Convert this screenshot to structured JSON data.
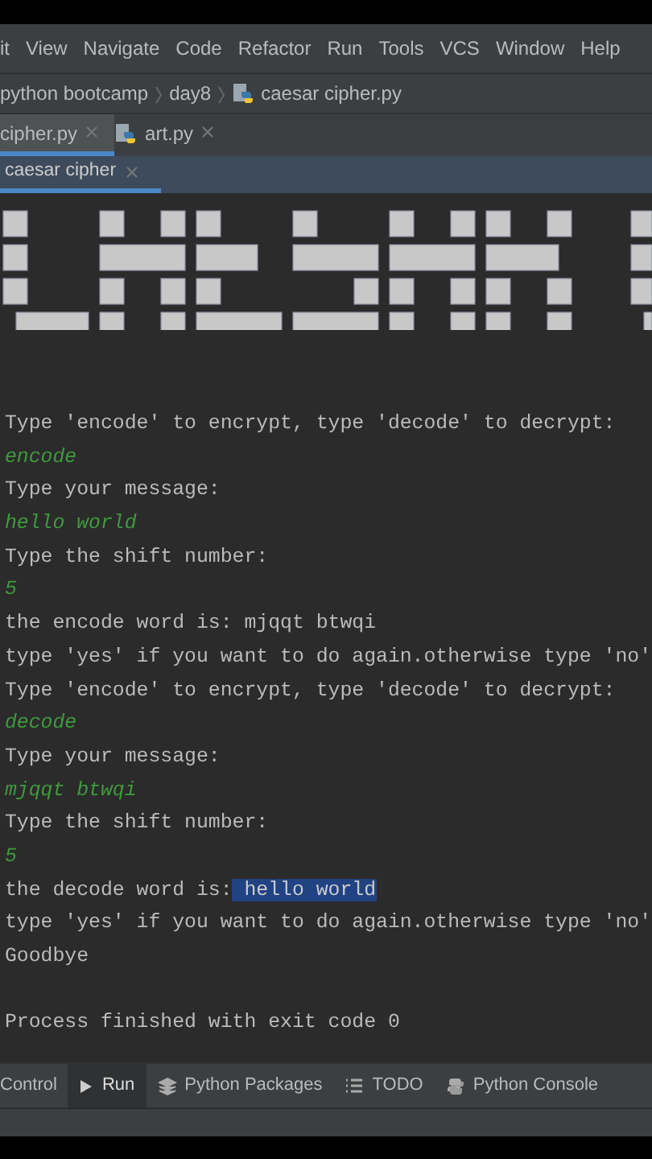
{
  "menu": [
    "it",
    "View",
    "Navigate",
    "Code",
    "Refactor",
    "Run",
    "Tools",
    "VCS",
    "Window",
    "Help"
  ],
  "breadcrumb": [
    {
      "label": "python bootcamp",
      "kind": "folder"
    },
    {
      "label": "day8",
      "kind": "folder"
    },
    {
      "label": "caesar cipher.py",
      "kind": "file"
    }
  ],
  "editor_tabs": [
    {
      "label": "cipher.py",
      "selected": true
    },
    {
      "label": "art.py",
      "selected": false
    }
  ],
  "run_tabs": [
    {
      "label": "caesar cipher",
      "selected": true
    }
  ],
  "console": [
    {
      "kind": "output",
      "text": "Type 'encode' to encrypt, type 'decode' to decrypt:"
    },
    {
      "kind": "input",
      "text": "encode"
    },
    {
      "kind": "output",
      "text": "Type your message:"
    },
    {
      "kind": "input",
      "text": "hello world"
    },
    {
      "kind": "output",
      "text": "Type the shift number:"
    },
    {
      "kind": "input",
      "text": "5"
    },
    {
      "kind": "output",
      "text": "the encode word is: mjqqt btwqi"
    },
    {
      "kind": "output",
      "text": "type 'yes' if you want to do again.otherwise type 'no'"
    },
    {
      "kind": "output",
      "text": "Type 'encode' to encrypt, type 'decode' to decrypt:"
    },
    {
      "kind": "input",
      "text": "decode"
    },
    {
      "kind": "output",
      "text": "Type your message:"
    },
    {
      "kind": "input",
      "text": "mjqqt btwqi"
    },
    {
      "kind": "output",
      "text": "Type the shift number:"
    },
    {
      "kind": "input",
      "text": "5"
    },
    {
      "kind": "output",
      "parts": [
        {
          "text": "the decode word is:",
          "selected": false
        },
        {
          "text": " hello world",
          "selected": true
        }
      ]
    },
    {
      "kind": "output",
      "text": "type 'yes' if you want to do again.otherwise type 'no'"
    },
    {
      "kind": "output",
      "text": "Goodbye"
    },
    {
      "kind": "blank"
    },
    {
      "kind": "output",
      "text": "Process finished with exit code 0"
    }
  ],
  "tool_tabs": [
    {
      "label": "Control",
      "kind": "plain",
      "selected": false
    },
    {
      "label": "Run",
      "kind": "run",
      "selected": true
    },
    {
      "label": "Python Packages",
      "kind": "packages",
      "selected": false
    },
    {
      "label": "TODO",
      "kind": "todo",
      "selected": false
    },
    {
      "label": "Python Console",
      "kind": "console",
      "selected": false
    }
  ]
}
